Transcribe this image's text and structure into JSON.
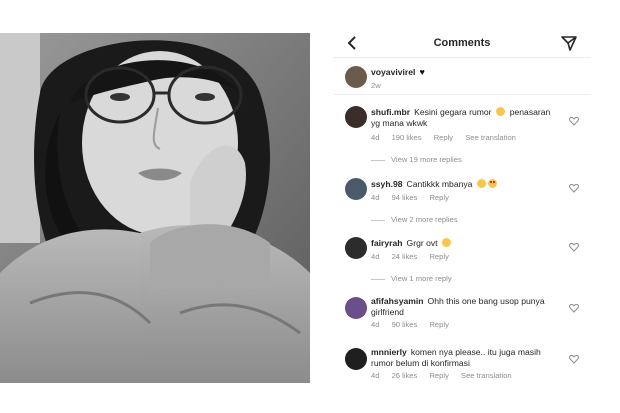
{
  "header": {
    "title": "Comments"
  },
  "caption": {
    "username": "voyavivirel",
    "time": "2w"
  },
  "comments": [
    {
      "username": "shufi.mbr",
      "text": "Kesini gegara rumor",
      "text2": "penasaran yg mana wkwk",
      "meta": {
        "time": "4d",
        "likes": "190 likes",
        "reply": "Reply",
        "translate": "See translation"
      },
      "more_replies": "View 19 more replies"
    },
    {
      "username": "ssyh.98",
      "text": "Cantikkk mbanya",
      "meta": {
        "time": "4d",
        "likes": "94 likes",
        "reply": "Reply"
      },
      "more_replies": "View 2 more replies"
    },
    {
      "username": "fairyrah",
      "text": "Grgr ovt",
      "meta": {
        "time": "4d",
        "likes": "24 likes",
        "reply": "Reply"
      },
      "more_replies": "View 1 more reply"
    },
    {
      "username": "afifahsyamin",
      "text": "Ohh this one bang usop punya girlfriend",
      "meta": {
        "time": "4d",
        "likes": "90 likes",
        "reply": "Reply"
      }
    },
    {
      "username": "mnnierly",
      "text": "komen nya please.. itu juga masih rumor belum di konfirmasi",
      "meta": {
        "time": "4d",
        "likes": "26 likes",
        "reply": "Reply",
        "translate": "See translation"
      }
    }
  ],
  "icons": {
    "back": "chevron-left-icon",
    "send": "send-icon",
    "like": "heart-outline-icon"
  },
  "colors": {
    "meta": "#8e8e8e",
    "text": "#262626"
  }
}
